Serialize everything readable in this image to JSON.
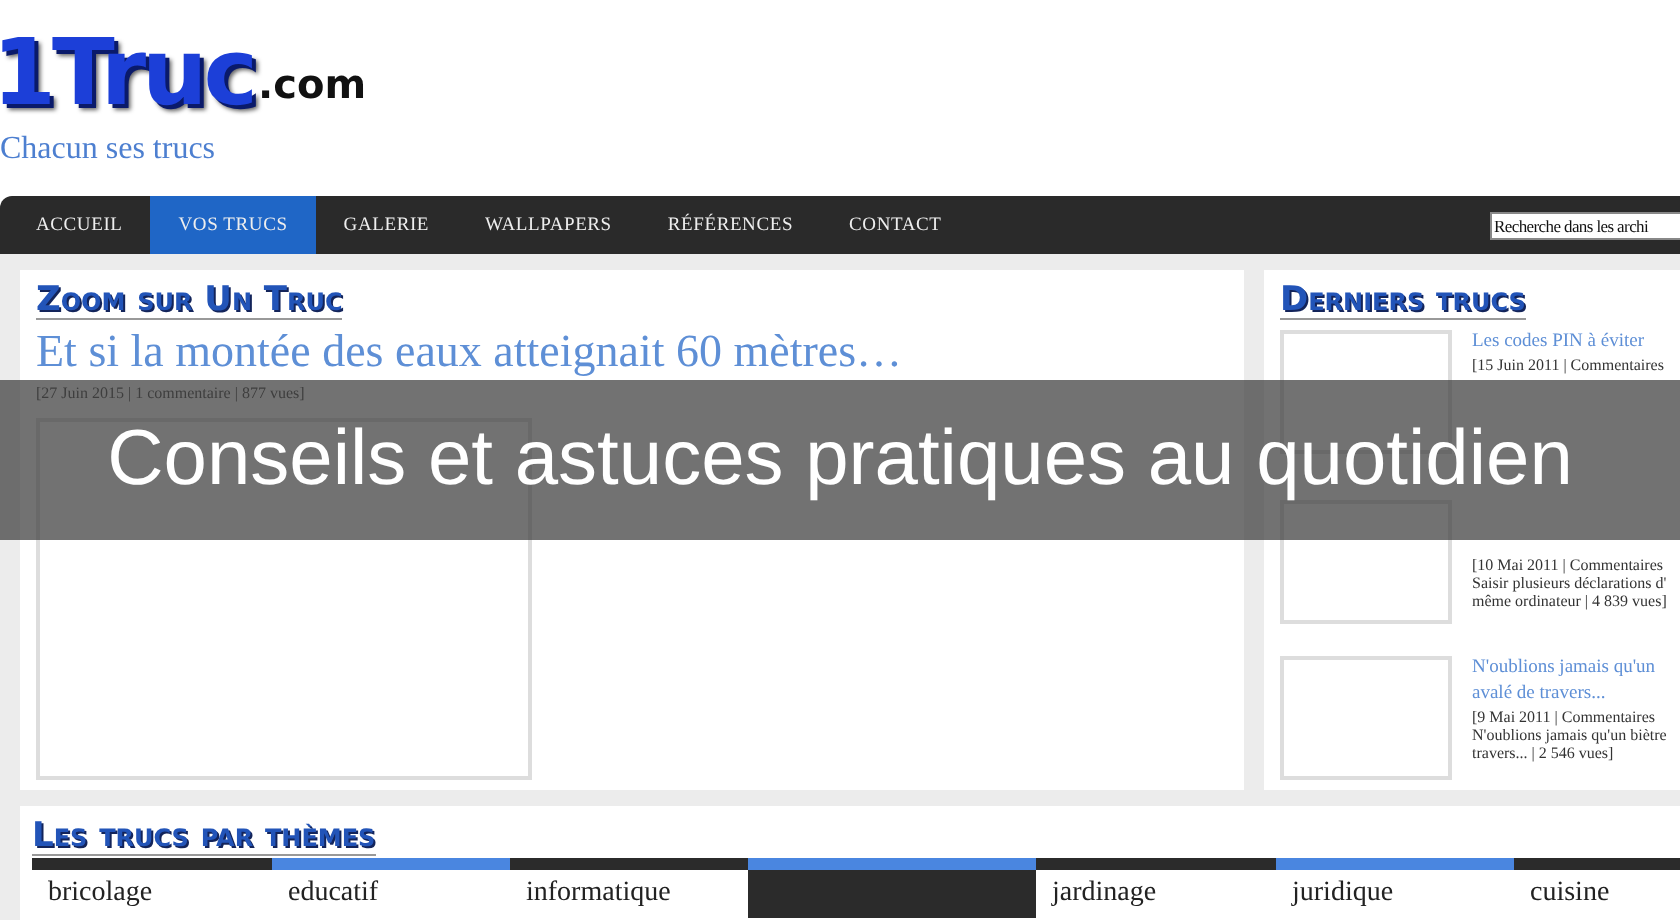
{
  "logo": {
    "mark": "1Truc",
    "suffix": ".com"
  },
  "tagline": "Chacun ses trucs",
  "nav": {
    "items": [
      {
        "label": "ACCUEIL",
        "selected": false
      },
      {
        "label": "VOS TRUCS",
        "selected": true
      },
      {
        "label": "GALERIE",
        "selected": false
      },
      {
        "label": "WALLPAPERS",
        "selected": false
      },
      {
        "label": "RÉFÉRENCES",
        "selected": false
      },
      {
        "label": "CONTACT",
        "selected": false
      }
    ],
    "search": {
      "value": "Recherche dans les archi"
    }
  },
  "zoom": {
    "heading": "Zoom sur Un Truc",
    "title": "Et si la montée des eaux atteignait 60 mètres…",
    "meta": "[27 Juin 2015 | 1 commentaire | 877 vues]"
  },
  "latest": {
    "heading": "Derniers trucs",
    "items": [
      {
        "title": [
          "Les codes PIN à éviter"
        ],
        "meta": "[15 Juin 2011 | Commentaires"
      },
      {
        "meta": "[10 Mai 2011 | Commentaires",
        "excerpt": [
          "Saisir plusieurs déclarations d'",
          "même ordinateur | 4 839 vues]"
        ]
      },
      {
        "title": [
          "N'oublions jamais qu'un",
          "avalé de travers..."
        ],
        "meta": "[9 Mai 2011 | Commentaires",
        "excerpt": [
          "N'oublions jamais qu'un biètre",
          "travers... | 2 546 vues]"
        ]
      }
    ]
  },
  "themes": {
    "heading": "Les trucs par thèmes",
    "items": [
      {
        "label": "bricolage",
        "selected": false,
        "color": "#2b2b2b"
      },
      {
        "label": "educatif",
        "selected": false,
        "color": "#4a86e0"
      },
      {
        "label": "informatique",
        "selected": false,
        "color": "#2b2b2b"
      },
      {
        "selected": true,
        "color": "#4a86e0"
      },
      {
        "label": "jardinage",
        "selected": false,
        "color": "#2b2b2b"
      },
      {
        "label": "juridique",
        "selected": false,
        "color": "#4a86e0"
      },
      {
        "label": "cuisine",
        "selected": false,
        "color": "#2b2b2b"
      }
    ]
  },
  "banner": "Conseils et astuces pratiques au quotidien"
}
